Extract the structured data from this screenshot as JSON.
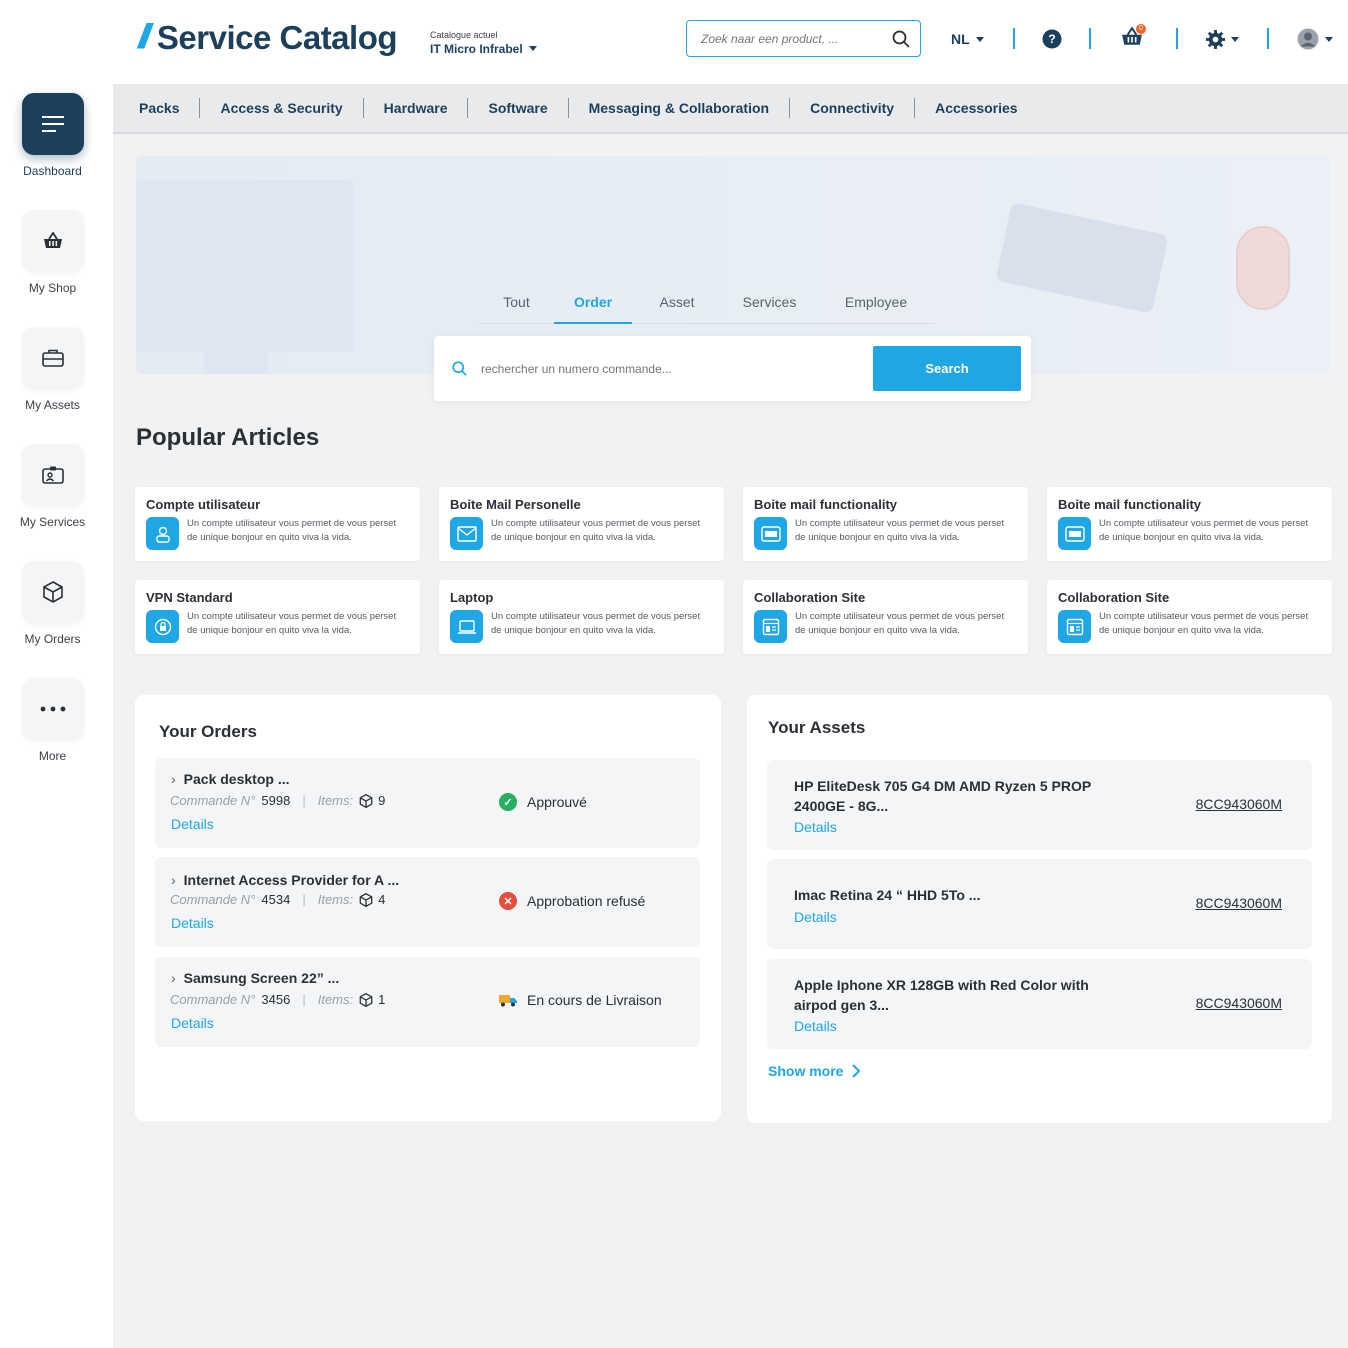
{
  "header": {
    "logo_slash": "//",
    "logo_text": "Service Catalog",
    "catalog_label": "Catalogue actuel",
    "catalog_name": "IT Micro Infrabel",
    "search_placeholder": "Zoek naar een product, ...",
    "language": "NL",
    "cart_count": "0"
  },
  "sidebar": {
    "items": [
      {
        "label": "Dashboard",
        "icon": "menu-lines-icon"
      },
      {
        "label": "My Shop",
        "icon": "basket-icon"
      },
      {
        "label": "My Assets",
        "icon": "briefcase-icon"
      },
      {
        "label": "My Services",
        "icon": "id-card-icon"
      },
      {
        "label": "My Orders",
        "icon": "box-icon"
      },
      {
        "label": "More",
        "icon": "dots-icon"
      }
    ]
  },
  "categories": [
    "Packs",
    "Access & Security",
    "Hardware",
    "Software",
    "Messaging & Collaboration",
    "Connectivity",
    "Accessories"
  ],
  "hero": {
    "tabs": [
      "Tout",
      "Order",
      "Asset",
      "Services",
      "Employee"
    ],
    "active_tab": "Order",
    "search_placeholder": "rechercher un numero commande...",
    "search_button": "Search"
  },
  "popular": {
    "title": "Popular Articles",
    "cards": [
      {
        "title": "Compte utilisateur",
        "desc": "Un compte utilisateur vous permet de vous perset de unique bonjour en quito viva la vida."
      },
      {
        "title": "Boite Mail Personelle",
        "desc": "Un compte utilisateur vous permet de vous perset de unique bonjour en quito viva la vida."
      },
      {
        "title": "Boite mail functionality",
        "desc": "Un compte utilisateur vous permet de vous perset de unique bonjour en quito viva la vida."
      },
      {
        "title": "Boite mail functionality",
        "desc": "Un compte utilisateur vous permet de vous perset de unique bonjour en quito viva la vida."
      },
      {
        "title": "VPN Standard",
        "desc": "Un compte utilisateur vous permet de vous perset de unique bonjour en quito viva la vida."
      },
      {
        "title": "Laptop",
        "desc": "Un compte utilisateur vous permet de vous perset de unique bonjour en quito viva la vida."
      },
      {
        "title": "Collaboration Site",
        "desc": "Un compte utilisateur vous permet de vous perset de unique bonjour en quito viva la vida."
      },
      {
        "title": "Collaboration Site",
        "desc": "Un compte utilisateur vous permet de vous perset de unique bonjour en quito viva la vida."
      }
    ]
  },
  "orders": {
    "title": "Your Orders",
    "commande_label": "Commande N°",
    "items_label": "Items:",
    "details_label": "Details",
    "list": [
      {
        "name": "Pack desktop  ...",
        "number": "5998",
        "items": "9",
        "status": "Approuvé",
        "status_color": "#27ae60"
      },
      {
        "name": "Internet Access Provider for A ...",
        "number": "4534",
        "items": "4",
        "status": "Approbation refusé",
        "status_color": "#e74c3c"
      },
      {
        "name": "Samsung Screen 22” ...",
        "number": "3456",
        "items": "1",
        "status": "En cours de Livraison",
        "status_color": "#f0a830"
      }
    ]
  },
  "assets": {
    "title": "Your Assets",
    "details_label": "Details",
    "show_more": "Show more",
    "list": [
      {
        "name": "HP EliteDesk 705 G4 DM AMD Ryzen 5 PROP 2400GE - 8G...",
        "code": "8CC943060M"
      },
      {
        "name": "Imac Retina 24 “ HHD 5To ...",
        "code": "8CC943060M"
      },
      {
        "name": "Apple Iphone XR 128GB with Red Color with airpod gen 3...",
        "code": "8CC943060M"
      }
    ]
  },
  "colors": {
    "accent": "#1ea7e4",
    "brand": "#1c3f5c",
    "background": "#f1f2f4"
  }
}
